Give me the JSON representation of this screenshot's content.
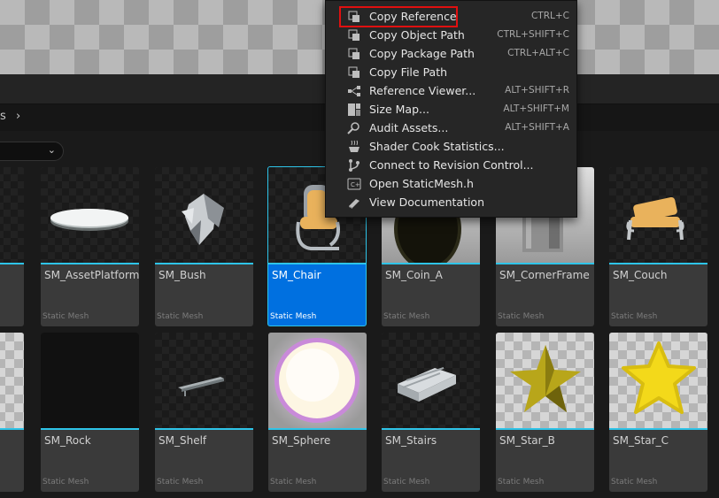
{
  "breadcrumb": {
    "tail": "s",
    "separator": "›"
  },
  "filter": {
    "arrow": "⌄"
  },
  "context_menu": {
    "items": [
      {
        "label": "Copy Reference",
        "shortcut": "CTRL+C",
        "icon": "copy-reference-icon"
      },
      {
        "label": "Copy Object Path",
        "shortcut": "CTRL+SHIFT+C",
        "icon": "copy-object-path-icon"
      },
      {
        "label": "Copy Package Path",
        "shortcut": "CTRL+ALT+C",
        "icon": "copy-package-path-icon"
      },
      {
        "label": "Copy File Path",
        "shortcut": "",
        "icon": "copy-file-path-icon"
      },
      {
        "label": "Reference Viewer...",
        "shortcut": "ALT+SHIFT+R",
        "icon": "reference-viewer-icon"
      },
      {
        "label": "Size Map...",
        "shortcut": "ALT+SHIFT+M",
        "icon": "size-map-icon"
      },
      {
        "label": "Audit Assets...",
        "shortcut": "ALT+SHIFT+A",
        "icon": "audit-assets-icon"
      },
      {
        "label": "Shader Cook Statistics...",
        "shortcut": "",
        "icon": "shader-cook-icon"
      },
      {
        "label": "Connect to Revision Control...",
        "shortcut": "",
        "icon": "revision-control-icon"
      },
      {
        "label": "Open StaticMesh.h",
        "shortcut": "",
        "icon": "open-header-icon"
      },
      {
        "label": "View Documentation",
        "shortcut": "",
        "icon": "documentation-icon"
      }
    ]
  },
  "assets_row1": [
    {
      "name": "SM_AssetPlatform",
      "type": "Static Mesh"
    },
    {
      "name": "SM_Bush",
      "type": "Static Mesh"
    },
    {
      "name": "SM_Chair",
      "type": "Static Mesh"
    },
    {
      "name": "SM_Coin_A",
      "type": "Static Mesh"
    },
    {
      "name": "SM_CornerFrame",
      "type": "Static Mesh"
    },
    {
      "name": "SM_Couch",
      "type": "Static Mesh"
    }
  ],
  "assets_row2": [
    {
      "name": "SM_Rock",
      "type": "Static Mesh"
    },
    {
      "name": "SM_Shelf",
      "type": "Static Mesh"
    },
    {
      "name": "SM_Sphere",
      "type": "Static Mesh"
    },
    {
      "name": "SM_Stairs",
      "type": "Static Mesh"
    },
    {
      "name": "SM_Star_B",
      "type": "Static Mesh"
    },
    {
      "name": "SM_Star_C",
      "type": "Static Mesh"
    }
  ],
  "colors": {
    "accent": "#2ec4e8",
    "selected": "#0070e0",
    "highlight_box": "#e01010"
  }
}
